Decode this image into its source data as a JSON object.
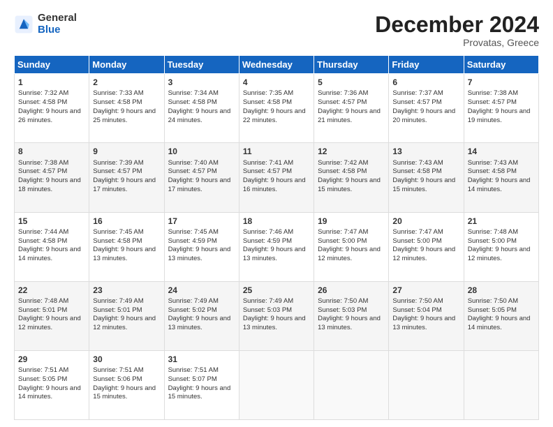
{
  "logo": {
    "general": "General",
    "blue": "Blue"
  },
  "header": {
    "month": "December 2024",
    "location": "Provatas, Greece"
  },
  "days": [
    "Sunday",
    "Monday",
    "Tuesday",
    "Wednesday",
    "Thursday",
    "Friday",
    "Saturday"
  ],
  "weeks": [
    [
      {
        "day": "1",
        "sunrise": "Sunrise: 7:32 AM",
        "sunset": "Sunset: 4:58 PM",
        "daylight": "Daylight: 9 hours and 26 minutes."
      },
      {
        "day": "2",
        "sunrise": "Sunrise: 7:33 AM",
        "sunset": "Sunset: 4:58 PM",
        "daylight": "Daylight: 9 hours and 25 minutes."
      },
      {
        "day": "3",
        "sunrise": "Sunrise: 7:34 AM",
        "sunset": "Sunset: 4:58 PM",
        "daylight": "Daylight: 9 hours and 24 minutes."
      },
      {
        "day": "4",
        "sunrise": "Sunrise: 7:35 AM",
        "sunset": "Sunset: 4:58 PM",
        "daylight": "Daylight: 9 hours and 22 minutes."
      },
      {
        "day": "5",
        "sunrise": "Sunrise: 7:36 AM",
        "sunset": "Sunset: 4:57 PM",
        "daylight": "Daylight: 9 hours and 21 minutes."
      },
      {
        "day": "6",
        "sunrise": "Sunrise: 7:37 AM",
        "sunset": "Sunset: 4:57 PM",
        "daylight": "Daylight: 9 hours and 20 minutes."
      },
      {
        "day": "7",
        "sunrise": "Sunrise: 7:38 AM",
        "sunset": "Sunset: 4:57 PM",
        "daylight": "Daylight: 9 hours and 19 minutes."
      }
    ],
    [
      {
        "day": "8",
        "sunrise": "Sunrise: 7:38 AM",
        "sunset": "Sunset: 4:57 PM",
        "daylight": "Daylight: 9 hours and 18 minutes."
      },
      {
        "day": "9",
        "sunrise": "Sunrise: 7:39 AM",
        "sunset": "Sunset: 4:57 PM",
        "daylight": "Daylight: 9 hours and 17 minutes."
      },
      {
        "day": "10",
        "sunrise": "Sunrise: 7:40 AM",
        "sunset": "Sunset: 4:57 PM",
        "daylight": "Daylight: 9 hours and 17 minutes."
      },
      {
        "day": "11",
        "sunrise": "Sunrise: 7:41 AM",
        "sunset": "Sunset: 4:57 PM",
        "daylight": "Daylight: 9 hours and 16 minutes."
      },
      {
        "day": "12",
        "sunrise": "Sunrise: 7:42 AM",
        "sunset": "Sunset: 4:58 PM",
        "daylight": "Daylight: 9 hours and 15 minutes."
      },
      {
        "day": "13",
        "sunrise": "Sunrise: 7:43 AM",
        "sunset": "Sunset: 4:58 PM",
        "daylight": "Daylight: 9 hours and 15 minutes."
      },
      {
        "day": "14",
        "sunrise": "Sunrise: 7:43 AM",
        "sunset": "Sunset: 4:58 PM",
        "daylight": "Daylight: 9 hours and 14 minutes."
      }
    ],
    [
      {
        "day": "15",
        "sunrise": "Sunrise: 7:44 AM",
        "sunset": "Sunset: 4:58 PM",
        "daylight": "Daylight: 9 hours and 14 minutes."
      },
      {
        "day": "16",
        "sunrise": "Sunrise: 7:45 AM",
        "sunset": "Sunset: 4:58 PM",
        "daylight": "Daylight: 9 hours and 13 minutes."
      },
      {
        "day": "17",
        "sunrise": "Sunrise: 7:45 AM",
        "sunset": "Sunset: 4:59 PM",
        "daylight": "Daylight: 9 hours and 13 minutes."
      },
      {
        "day": "18",
        "sunrise": "Sunrise: 7:46 AM",
        "sunset": "Sunset: 4:59 PM",
        "daylight": "Daylight: 9 hours and 13 minutes."
      },
      {
        "day": "19",
        "sunrise": "Sunrise: 7:47 AM",
        "sunset": "Sunset: 5:00 PM",
        "daylight": "Daylight: 9 hours and 12 minutes."
      },
      {
        "day": "20",
        "sunrise": "Sunrise: 7:47 AM",
        "sunset": "Sunset: 5:00 PM",
        "daylight": "Daylight: 9 hours and 12 minutes."
      },
      {
        "day": "21",
        "sunrise": "Sunrise: 7:48 AM",
        "sunset": "Sunset: 5:00 PM",
        "daylight": "Daylight: 9 hours and 12 minutes."
      }
    ],
    [
      {
        "day": "22",
        "sunrise": "Sunrise: 7:48 AM",
        "sunset": "Sunset: 5:01 PM",
        "daylight": "Daylight: 9 hours and 12 minutes."
      },
      {
        "day": "23",
        "sunrise": "Sunrise: 7:49 AM",
        "sunset": "Sunset: 5:01 PM",
        "daylight": "Daylight: 9 hours and 12 minutes."
      },
      {
        "day": "24",
        "sunrise": "Sunrise: 7:49 AM",
        "sunset": "Sunset: 5:02 PM",
        "daylight": "Daylight: 9 hours and 13 minutes."
      },
      {
        "day": "25",
        "sunrise": "Sunrise: 7:49 AM",
        "sunset": "Sunset: 5:03 PM",
        "daylight": "Daylight: 9 hours and 13 minutes."
      },
      {
        "day": "26",
        "sunrise": "Sunrise: 7:50 AM",
        "sunset": "Sunset: 5:03 PM",
        "daylight": "Daylight: 9 hours and 13 minutes."
      },
      {
        "day": "27",
        "sunrise": "Sunrise: 7:50 AM",
        "sunset": "Sunset: 5:04 PM",
        "daylight": "Daylight: 9 hours and 13 minutes."
      },
      {
        "day": "28",
        "sunrise": "Sunrise: 7:50 AM",
        "sunset": "Sunset: 5:05 PM",
        "daylight": "Daylight: 9 hours and 14 minutes."
      }
    ],
    [
      {
        "day": "29",
        "sunrise": "Sunrise: 7:51 AM",
        "sunset": "Sunset: 5:05 PM",
        "daylight": "Daylight: 9 hours and 14 minutes."
      },
      {
        "day": "30",
        "sunrise": "Sunrise: 7:51 AM",
        "sunset": "Sunset: 5:06 PM",
        "daylight": "Daylight: 9 hours and 15 minutes."
      },
      {
        "day": "31",
        "sunrise": "Sunrise: 7:51 AM",
        "sunset": "Sunset: 5:07 PM",
        "daylight": "Daylight: 9 hours and 15 minutes."
      },
      null,
      null,
      null,
      null
    ]
  ]
}
